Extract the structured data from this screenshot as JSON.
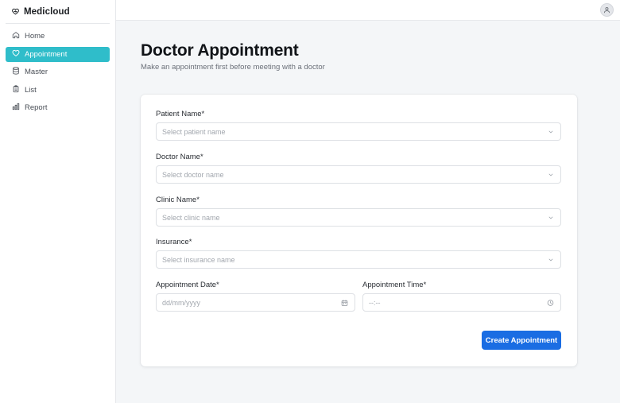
{
  "app": {
    "name": "Medicloud"
  },
  "sidebar": {
    "items": [
      {
        "label": "Home",
        "icon": "home-icon",
        "active": false
      },
      {
        "label": "Appointment",
        "icon": "heart-icon",
        "active": true
      },
      {
        "label": "Master",
        "icon": "database-icon",
        "active": false
      },
      {
        "label": "List",
        "icon": "clipboard-icon",
        "active": false
      },
      {
        "label": "Report",
        "icon": "bar-chart-icon",
        "active": false
      }
    ]
  },
  "header": {
    "avatar_icon": "user-icon"
  },
  "page": {
    "title": "Doctor Appointment",
    "subtitle": "Make an appointment first before meeting with a doctor"
  },
  "form": {
    "patient": {
      "label": "Patient Name*",
      "placeholder": "Select patient name"
    },
    "doctor": {
      "label": "Doctor Name*",
      "placeholder": "Select doctor name"
    },
    "clinic": {
      "label": "Clinic Name*",
      "placeholder": "Select clinic name"
    },
    "insurance": {
      "label": "Insurance*",
      "placeholder": "Select insurance name"
    },
    "date": {
      "label": "Appointment Date*",
      "placeholder": "dd/mm/yyyy"
    },
    "time": {
      "label": "Appointment Time*",
      "placeholder": "--:--"
    },
    "submit_label": "Create Appointment"
  },
  "colors": {
    "accent": "#2fbdca",
    "primary_button": "#1a6de3"
  }
}
